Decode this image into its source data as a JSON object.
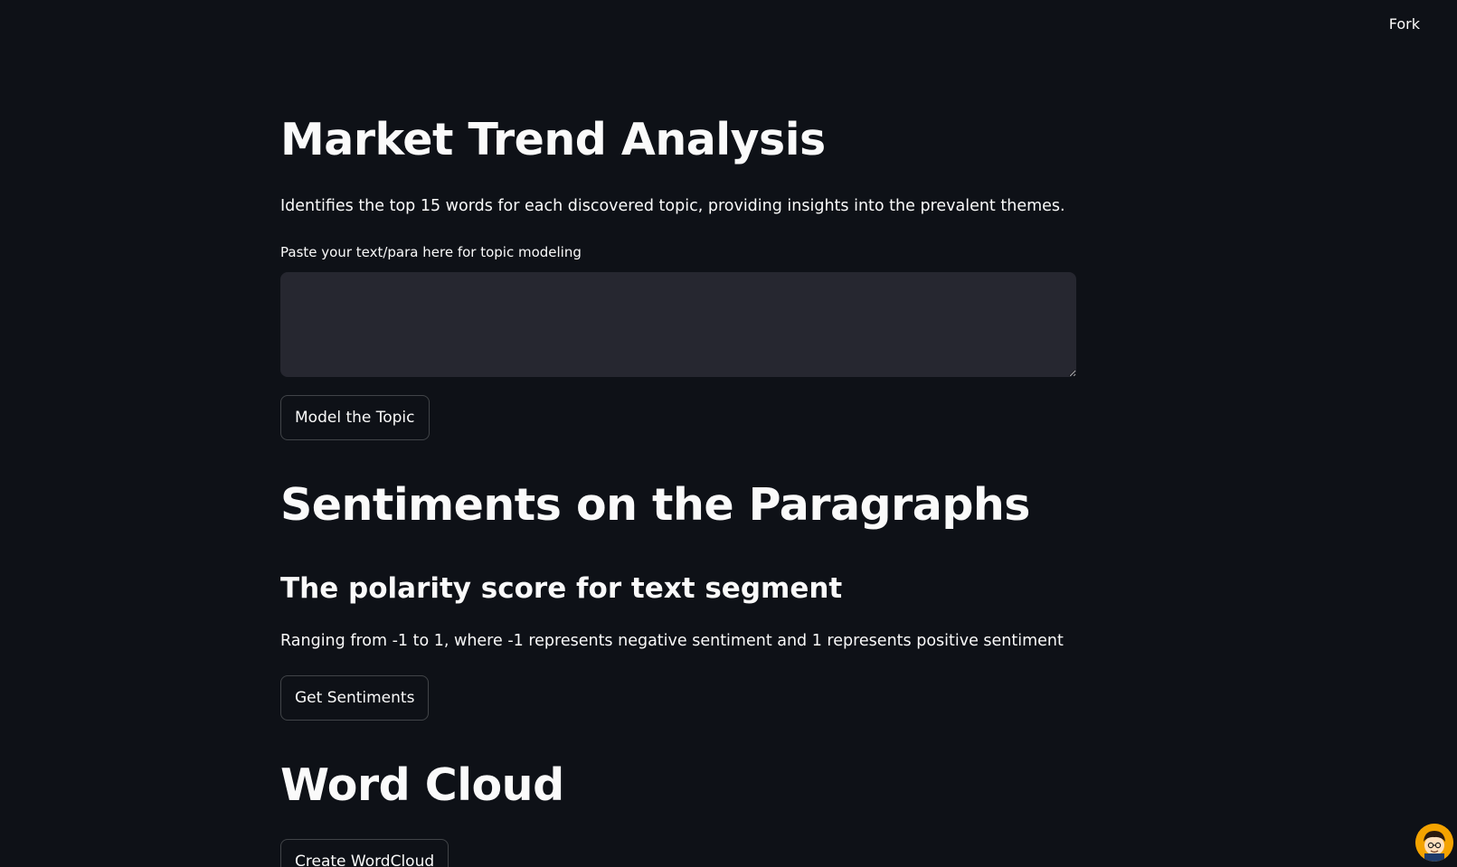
{
  "header": {
    "fork_label": "Fork"
  },
  "topic": {
    "title": "Market Trend Analysis",
    "description": "Identifies the top 15 words for each discovered topic, providing insights into the prevalent themes.",
    "input_label": "Paste your text/para here for topic modeling",
    "input_value": "",
    "button_label": "Model the Topic"
  },
  "sentiment": {
    "title": "Sentiments on the Paragraphs",
    "subtitle": "The polarity score for text segment",
    "description": "Ranging from -1 to 1, where -1 represents negative sentiment and 1 represents positive sentiment",
    "button_label": "Get Sentiments"
  },
  "wordcloud": {
    "title": "Word Cloud",
    "button_label": "Create WordCloud"
  },
  "colors": {
    "background": "#0e1117",
    "text": "#fafafa",
    "input_background": "#262730",
    "avatar_accent": "#f4a300"
  },
  "icons": {
    "avatar": "user-avatar-icon"
  }
}
